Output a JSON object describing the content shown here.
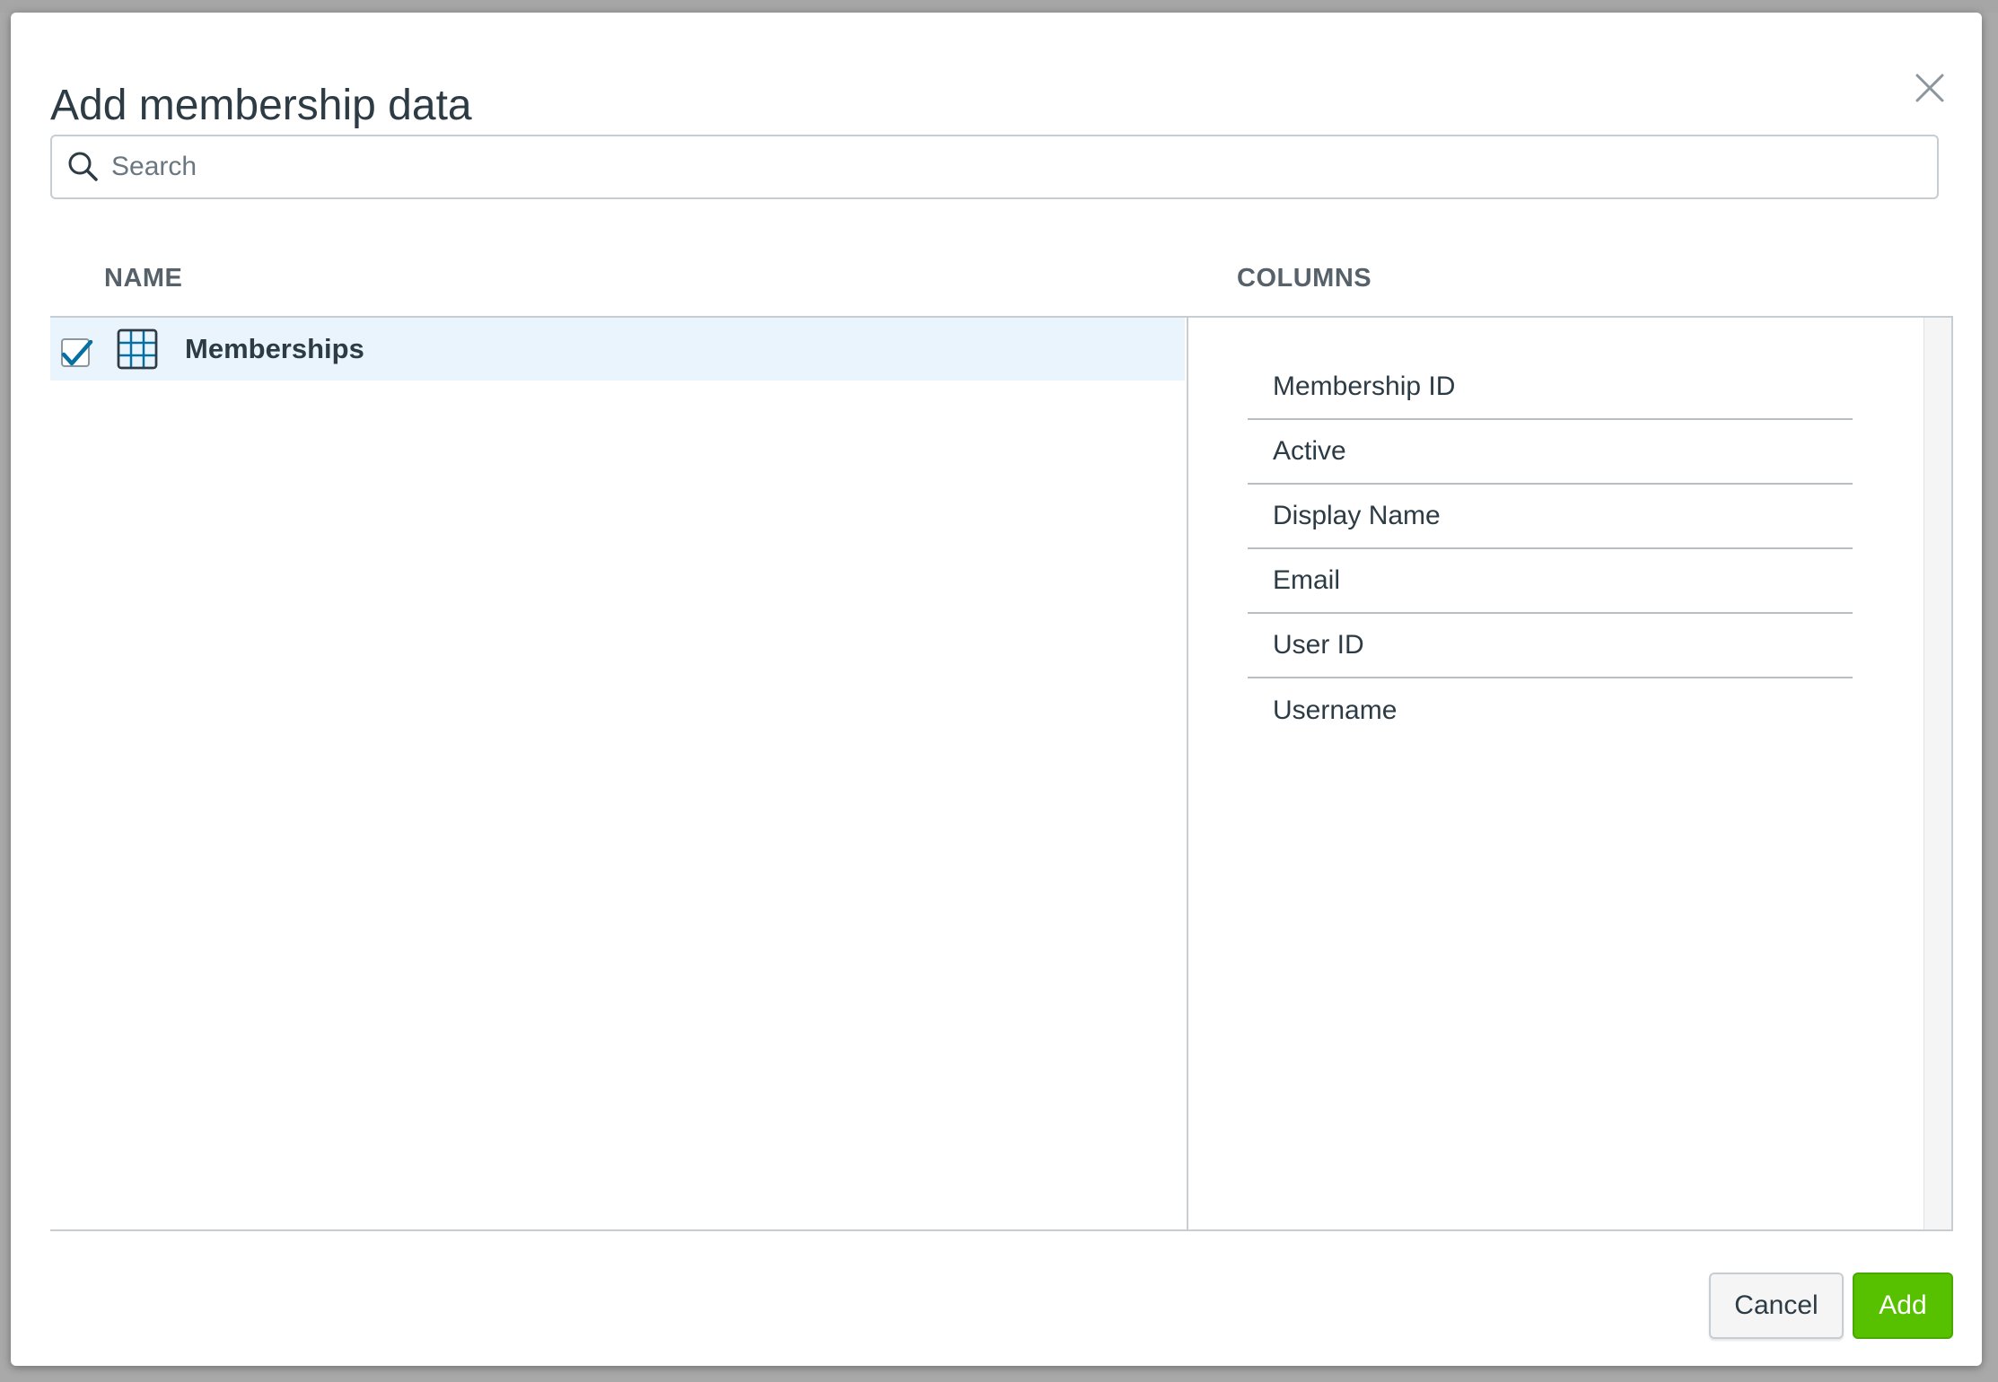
{
  "dialog": {
    "title": "Add membership data",
    "close_icon": "close-icon"
  },
  "search": {
    "placeholder": "Search",
    "value": "",
    "icon": "search-icon"
  },
  "headers": {
    "name": "NAME",
    "columns": "COLUMNS"
  },
  "tables": [
    {
      "name": "Memberships",
      "checked": true,
      "icon": "table-grid-icon"
    }
  ],
  "columns": [
    "Membership ID",
    "Active",
    "Display Name",
    "Email",
    "User ID",
    "Username"
  ],
  "actions": {
    "cancel_label": "Cancel",
    "add_label": "Add"
  },
  "colors": {
    "accent_blue": "#0770a3",
    "add_green": "#57c100",
    "selected_row": "#eaf4fd"
  }
}
